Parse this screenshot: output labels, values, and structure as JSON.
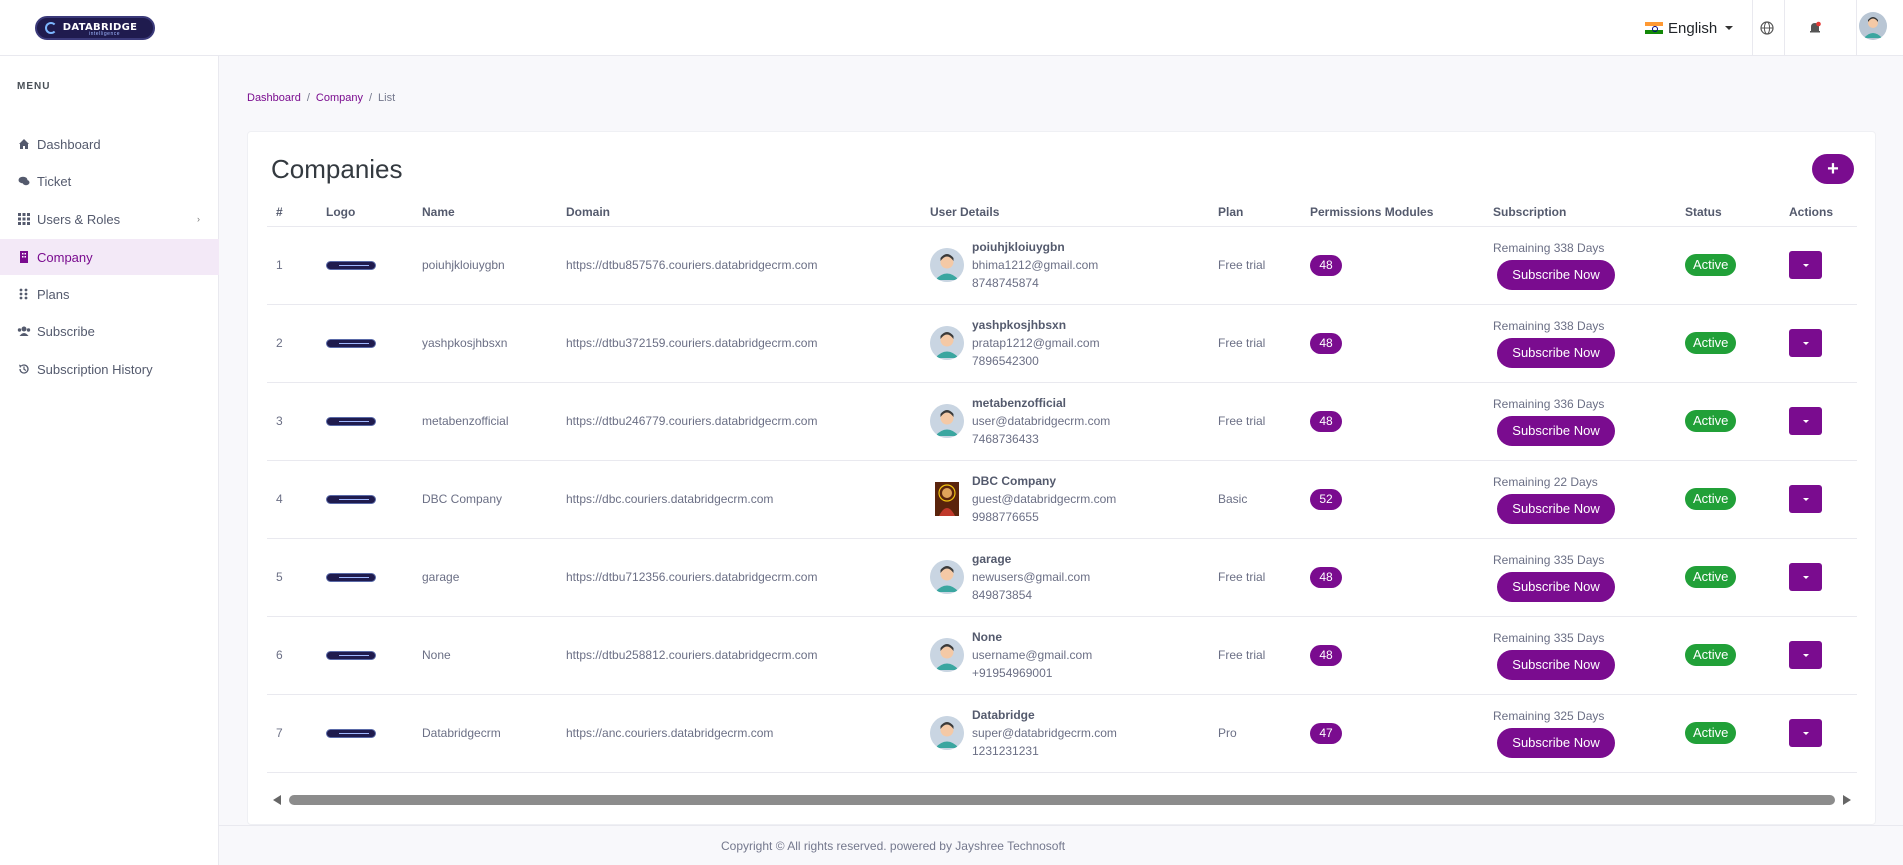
{
  "header": {
    "logo_text": "DATABRIDGE",
    "logo_sub": "intelligence",
    "language": "English",
    "icons": [
      "globe-icon",
      "bell-icon",
      "user-avatar"
    ]
  },
  "sidebar": {
    "menu_title": "MENU",
    "items": [
      {
        "label": "Dashboard",
        "icon": "home-icon"
      },
      {
        "label": "Ticket",
        "icon": "chat-icon"
      },
      {
        "label": "Users & Roles",
        "icon": "grid-icon",
        "has_arrow": true
      },
      {
        "label": "Company",
        "icon": "building-icon",
        "active": true
      },
      {
        "label": "Plans",
        "icon": "dots-grid-icon"
      },
      {
        "label": "Subscribe",
        "icon": "users-icon"
      },
      {
        "label": "Subscription History",
        "icon": "history-icon"
      }
    ]
  },
  "breadcrumb": [
    "Dashboard",
    "Company",
    "List"
  ],
  "page": {
    "title": "Companies",
    "add_button": "+"
  },
  "table": {
    "columns": [
      "#",
      "Logo",
      "Name",
      "Domain",
      "User Details",
      "Plan",
      "Permissions Modules",
      "Subscription",
      "Status",
      "Actions"
    ],
    "rows": [
      {
        "num": "1",
        "name": "poiuhjkloiuygbn",
        "domain": "https://dtbu857576.couriers.databridgecrm.com",
        "user_name": "poiuhjkloiuygbn",
        "email": "bhima1212@gmail.com",
        "phone": "8748745874",
        "plan": "Free trial",
        "perm": "48",
        "remaining": "Remaining 338 Days",
        "sub_btn": "Subscribe Now",
        "status": "Active"
      },
      {
        "num": "2",
        "name": "yashpkosjhbsxn",
        "domain": "https://dtbu372159.couriers.databridgecrm.com",
        "user_name": "yashpkosjhbsxn",
        "email": "pratap1212@gmail.com",
        "phone": "7896542300",
        "plan": "Free trial",
        "perm": "48",
        "remaining": "Remaining 338 Days",
        "sub_btn": "Subscribe Now",
        "status": "Active"
      },
      {
        "num": "3",
        "name": "metabenzofficial",
        "domain": "https://dtbu246779.couriers.databridgecrm.com",
        "user_name": "metabenzofficial",
        "email": "user@databridgecrm.com",
        "phone": "7468736433",
        "plan": "Free trial",
        "perm": "48",
        "remaining": "Remaining 336 Days",
        "sub_btn": "Subscribe Now",
        "status": "Active"
      },
      {
        "num": "4",
        "name": "DBC Company",
        "domain": "https://dbc.couriers.databridgecrm.com",
        "user_name": "DBC Company",
        "email": "guest@databridgecrm.com",
        "phone": "9988776655",
        "plan": "Basic",
        "perm": "52",
        "remaining": "Remaining 22 Days",
        "sub_btn": "Subscribe Now",
        "status": "Active",
        "photo": true
      },
      {
        "num": "5",
        "name": "garage",
        "domain": "https://dtbu712356.couriers.databridgecrm.com",
        "user_name": "garage",
        "email": "newusers@gmail.com",
        "phone": "849873854",
        "plan": "Free trial",
        "perm": "48",
        "remaining": "Remaining 335 Days",
        "sub_btn": "Subscribe Now",
        "status": "Active"
      },
      {
        "num": "6",
        "name": "None",
        "domain": "https://dtbu258812.couriers.databridgecrm.com",
        "user_name": "None",
        "email": "username@gmail.com",
        "phone": "+91954969001",
        "plan": "Free trial",
        "perm": "48",
        "remaining": "Remaining 335 Days",
        "sub_btn": "Subscribe Now",
        "status": "Active"
      },
      {
        "num": "7",
        "name": "Databridgecrm",
        "domain": "https://anc.couriers.databridgecrm.com",
        "user_name": "Databridge",
        "email": "super@databridgecrm.com",
        "phone": "1231231231",
        "plan": "Pro",
        "perm": "47",
        "remaining": "Remaining 325 Days",
        "sub_btn": "Subscribe Now",
        "status": "Active"
      }
    ]
  },
  "footer": {
    "text": "Copyright © All rights reserved. powered by Jayshree Technosoft"
  },
  "colors": {
    "accent": "#7a0c8f",
    "status_active": "#21a038",
    "active_nav_bg": "#f3e9f7"
  }
}
